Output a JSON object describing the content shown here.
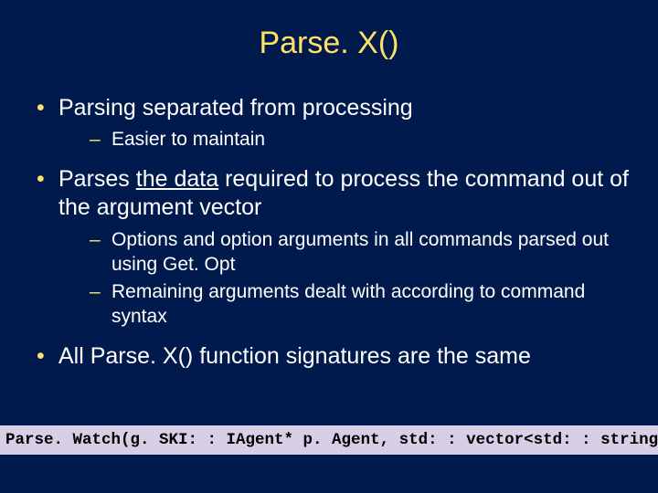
{
  "title": "Parse. X()",
  "bullets": [
    {
      "text": "Parsing separated from processing",
      "sub": [
        "Easier to maintain"
      ]
    },
    {
      "prefix": "Parses ",
      "underlined": "the data",
      "suffix": " required to process the command out of the argument vector",
      "sub": [
        "Options and option arguments in all commands parsed out using Get. Opt",
        "Remaining arguments dealt with according to command syntax"
      ]
    },
    {
      "text": "All Parse. X() function signatures are the same",
      "sub": []
    }
  ],
  "code": "Parse. Watch(g. SKI: : IAgent* p. Agent,  std: : vector<std: : string>& argv)"
}
